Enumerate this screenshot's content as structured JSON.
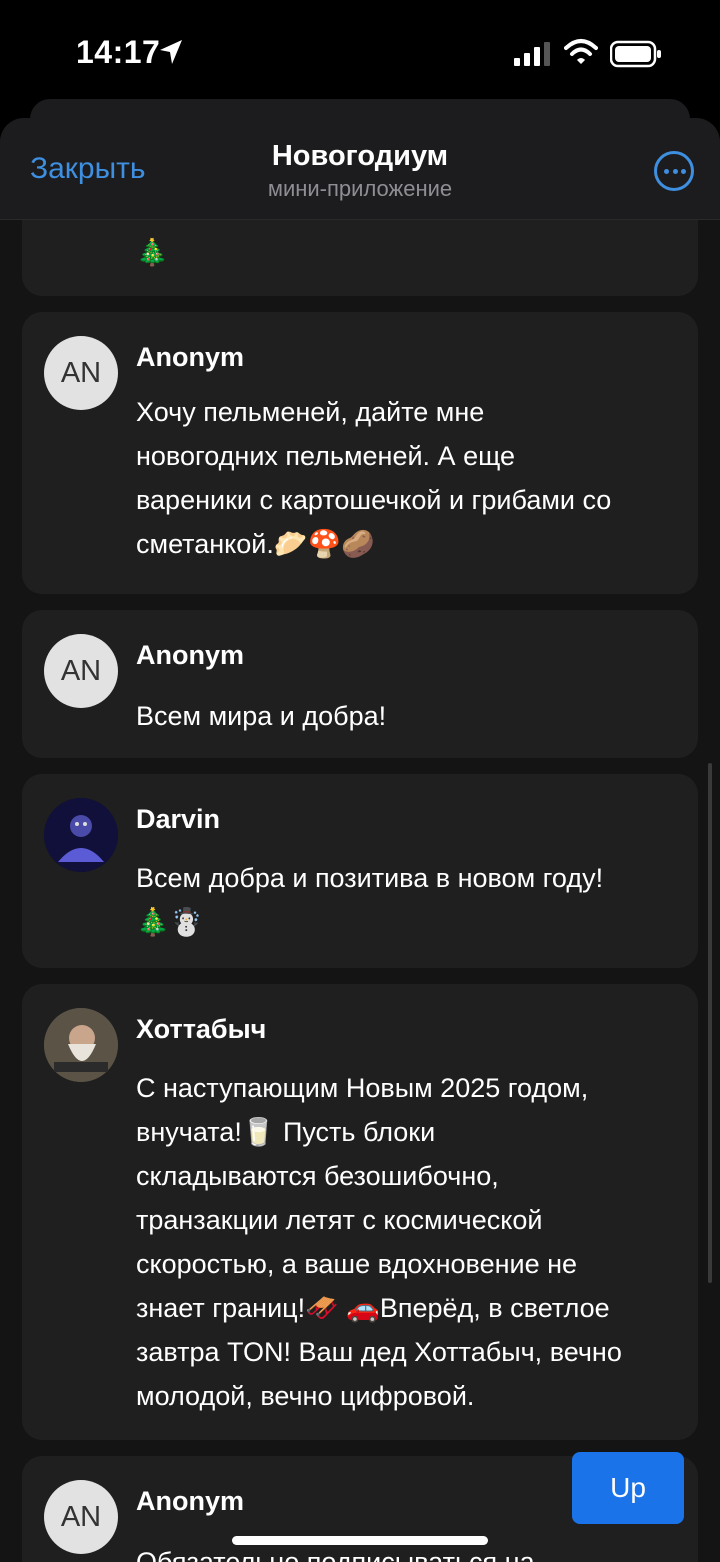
{
  "status": {
    "time": "14:17"
  },
  "header": {
    "close_label": "Закрыть",
    "title": "Новогодиум",
    "subtitle": "мини-приложение"
  },
  "messages": [
    {
      "author": "",
      "avatar_text": "",
      "text": "🎄"
    },
    {
      "author": "Anonym",
      "avatar_text": "AN",
      "lines": [
        "Хочу пельменей, дайте мне",
        "новогодних пельменей. А еще",
        "вареники с картошечкой и грибами со",
        "сметанкой.🥟🍄🥔"
      ]
    },
    {
      "author": "Anonym",
      "avatar_text": "AN",
      "lines": [
        "Всем мира и добра!"
      ]
    },
    {
      "author": "Darvin",
      "avatar_text": "",
      "lines": [
        "Всем добра и позитива в новом году!",
        "🎄☃️"
      ]
    },
    {
      "author": "Хоттабыч",
      "avatar_text": "",
      "lines": [
        "С наступающим Новым 2025 годом,",
        "внучата!🥛 Пусть блоки",
        "складываются безошибочно,",
        "транзакции летят с космической",
        "скоростью, а ваше вдохновение не",
        "знает границ!🛷 🚗Вперёд, в светлое",
        "завтра TON! Ваш дед Хоттабыч, вечно",
        "молодой, вечно цифровой."
      ]
    },
    {
      "author": "Anonym",
      "avatar_text": "AN",
      "lines": [
        "Обязательно подписываться на"
      ]
    }
  ],
  "up_button": "Up",
  "colors": {
    "accent": "#3e8fe0",
    "card": "#1f1f1f",
    "button": "#1a73e8"
  }
}
